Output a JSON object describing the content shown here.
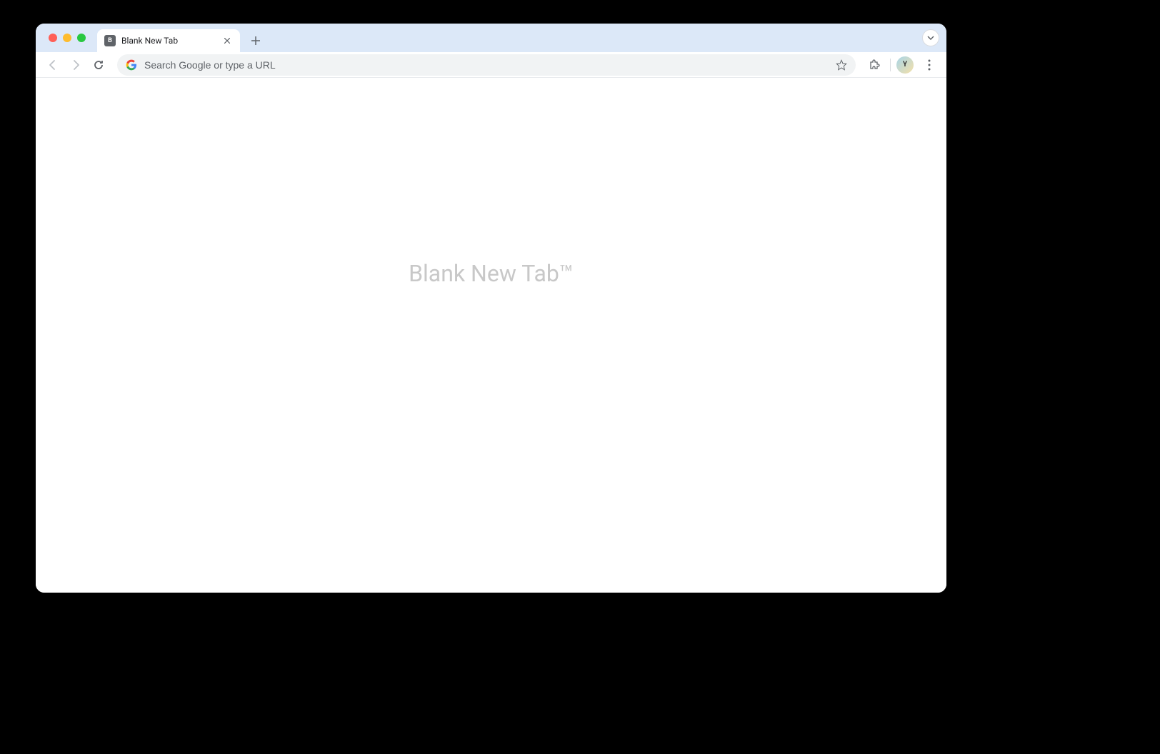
{
  "tab": {
    "title": "Blank New Tab",
    "favicon_letter": "B"
  },
  "address_bar": {
    "placeholder": "Search Google or type a URL"
  },
  "page": {
    "heading": "Blank New Tab™"
  },
  "profile": {
    "initial": "Y"
  }
}
